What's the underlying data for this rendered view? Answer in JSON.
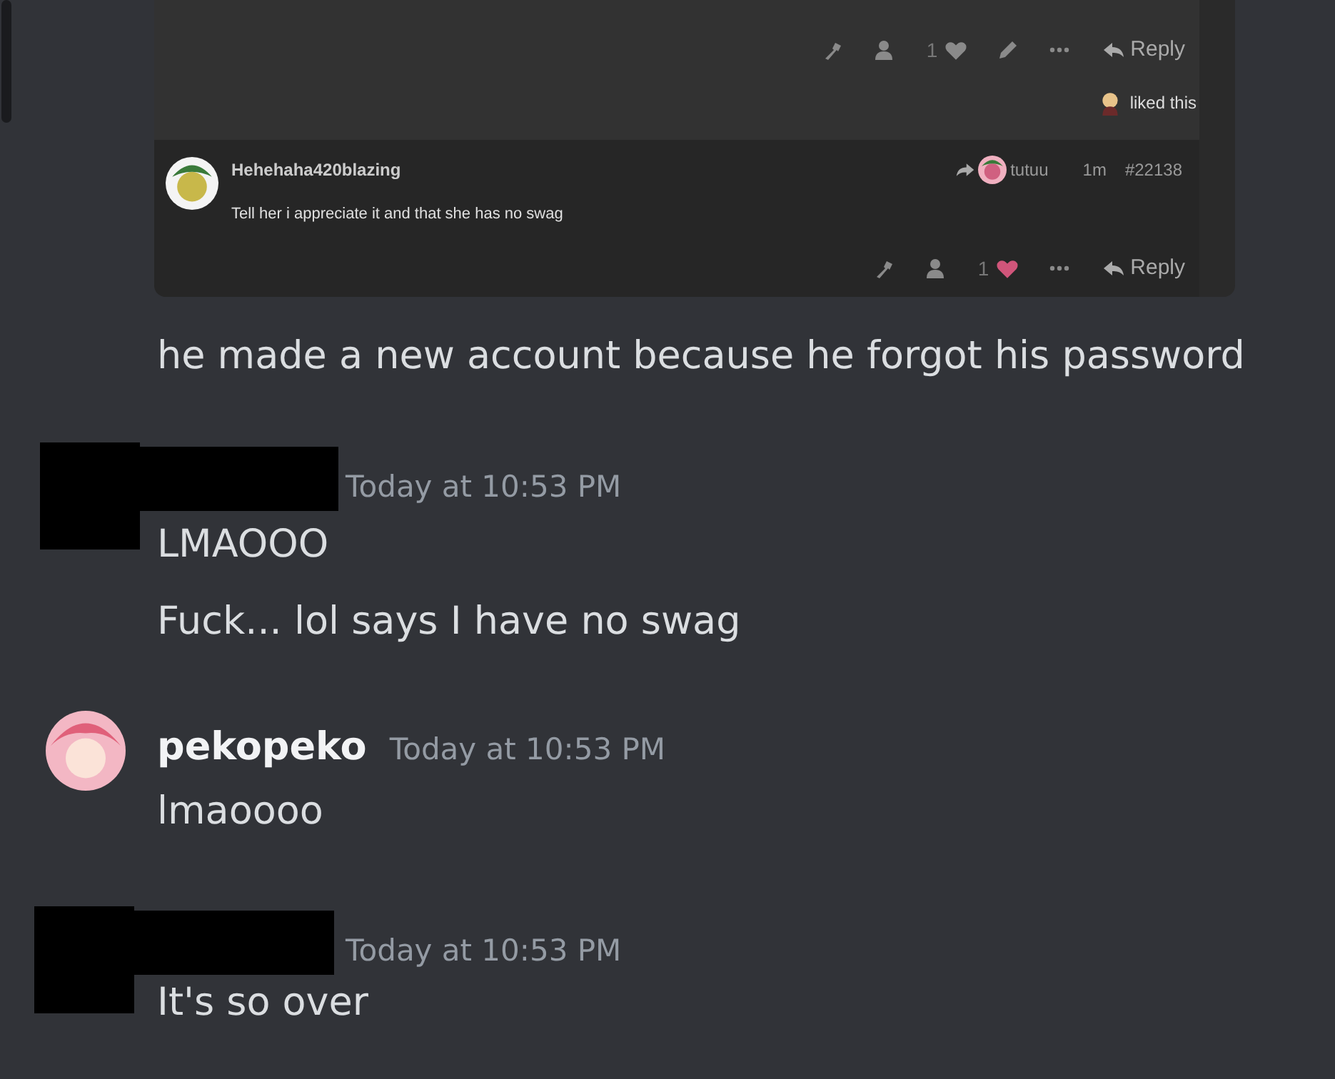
{
  "embed": {
    "top_post": {
      "like_count": "1",
      "liked": false,
      "reply": "Reply",
      "liked_note": "liked this"
    },
    "reply_post": {
      "author": "Hehehaha420blazing",
      "reply_to": "tutuu",
      "age": "1m",
      "number": "#22138",
      "text": "Tell her i appreciate it and that she has no swag",
      "like_count": "1",
      "liked": true,
      "reply": "Reply"
    }
  },
  "messages": [
    {
      "kind": "continuation",
      "lines": [
        "he made a new account because he forgot his password"
      ]
    },
    {
      "kind": "redacted",
      "timestamp": "Today at 10:53 PM",
      "lines": [
        "LMAOOO",
        "Fuck... lol says I have no swag"
      ]
    },
    {
      "kind": "user",
      "username": "pekopeko",
      "timestamp": "Today at 10:53 PM",
      "lines": [
        "lmaoooo"
      ]
    },
    {
      "kind": "redacted",
      "timestamp": "Today at 10:53 PM",
      "lines": [
        "It's so over"
      ]
    }
  ]
}
